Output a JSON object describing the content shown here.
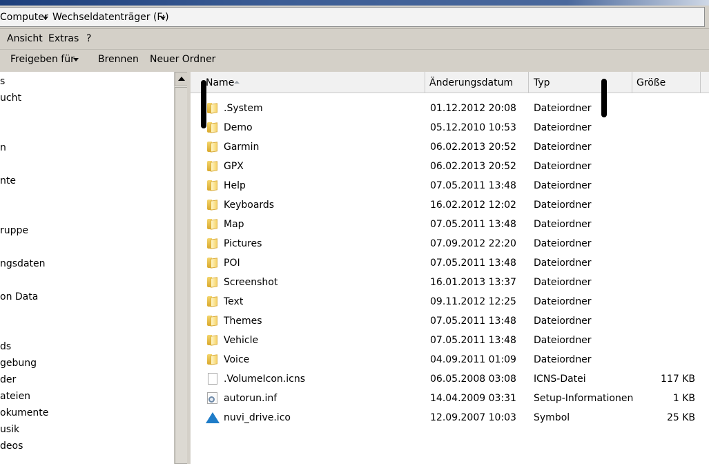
{
  "address": {
    "crumb_1": "Computer",
    "crumb_2": "Wechseldatenträger (F:)"
  },
  "menu": {
    "ansicht": "Ansicht",
    "extras": "Extras",
    "help": "?"
  },
  "toolbar": {
    "share": "Freigeben für",
    "burn": "Brennen",
    "new_folder": "Neuer Ordner"
  },
  "nav": {
    "items": [
      "s",
      "ucht",
      "n",
      "nte",
      "ruppe",
      "ngsdaten",
      "on Data",
      "ds",
      "gebung",
      "der",
      "ateien",
      "okumente",
      "usik",
      "deos"
    ]
  },
  "columns": {
    "name": "Name",
    "date": "Änderungsdatum",
    "type": "Typ",
    "size": "Größe"
  },
  "files": [
    {
      "name": ".System",
      "date": "01.12.2012 20:08",
      "type": "Dateiordner",
      "size": "",
      "icon": "folder-icon"
    },
    {
      "name": "Demo",
      "date": "05.12.2010 10:53",
      "type": "Dateiordner",
      "size": "",
      "icon": "folder-icon"
    },
    {
      "name": "Garmin",
      "date": "06.02.2013 20:52",
      "type": "Dateiordner",
      "size": "",
      "icon": "folder-icon"
    },
    {
      "name": "GPX",
      "date": "06.02.2013 20:52",
      "type": "Dateiordner",
      "size": "",
      "icon": "folder-icon"
    },
    {
      "name": "Help",
      "date": "07.05.2011 13:48",
      "type": "Dateiordner",
      "size": "",
      "icon": "folder-icon"
    },
    {
      "name": "Keyboards",
      "date": "16.02.2012 12:02",
      "type": "Dateiordner",
      "size": "",
      "icon": "folder-icon"
    },
    {
      "name": "Map",
      "date": "07.05.2011 13:48",
      "type": "Dateiordner",
      "size": "",
      "icon": "folder-icon"
    },
    {
      "name": "Pictures",
      "date": "07.09.2012 22:20",
      "type": "Dateiordner",
      "size": "",
      "icon": "folder-icon"
    },
    {
      "name": "POI",
      "date": "07.05.2011 13:48",
      "type": "Dateiordner",
      "size": "",
      "icon": "folder-icon"
    },
    {
      "name": "Screenshot",
      "date": "16.01.2013 13:37",
      "type": "Dateiordner",
      "size": "",
      "icon": "folder-icon"
    },
    {
      "name": "Text",
      "date": "09.11.2012 12:25",
      "type": "Dateiordner",
      "size": "",
      "icon": "folder-icon"
    },
    {
      "name": "Themes",
      "date": "07.05.2011 13:48",
      "type": "Dateiordner",
      "size": "",
      "icon": "folder-icon"
    },
    {
      "name": "Vehicle",
      "date": "07.05.2011 13:48",
      "type": "Dateiordner",
      "size": "",
      "icon": "folder-icon"
    },
    {
      "name": "Voice",
      "date": "04.09.2011 01:09",
      "type": "Dateiordner",
      "size": "",
      "icon": "folder-icon"
    },
    {
      "name": ".VolumeIcon.icns",
      "date": "06.05.2008 03:08",
      "type": "ICNS-Datei",
      "size": "117 KB",
      "icon": "file-icon"
    },
    {
      "name": "autorun.inf",
      "date": "14.04.2009 03:31",
      "type": "Setup-Informationen",
      "size": "1 KB",
      "icon": "settings-file-icon"
    },
    {
      "name": "nuvi_drive.ico",
      "date": "12.09.2007 10:03",
      "type": "Symbol",
      "size": "25 KB",
      "icon": "triangle-icon"
    }
  ]
}
